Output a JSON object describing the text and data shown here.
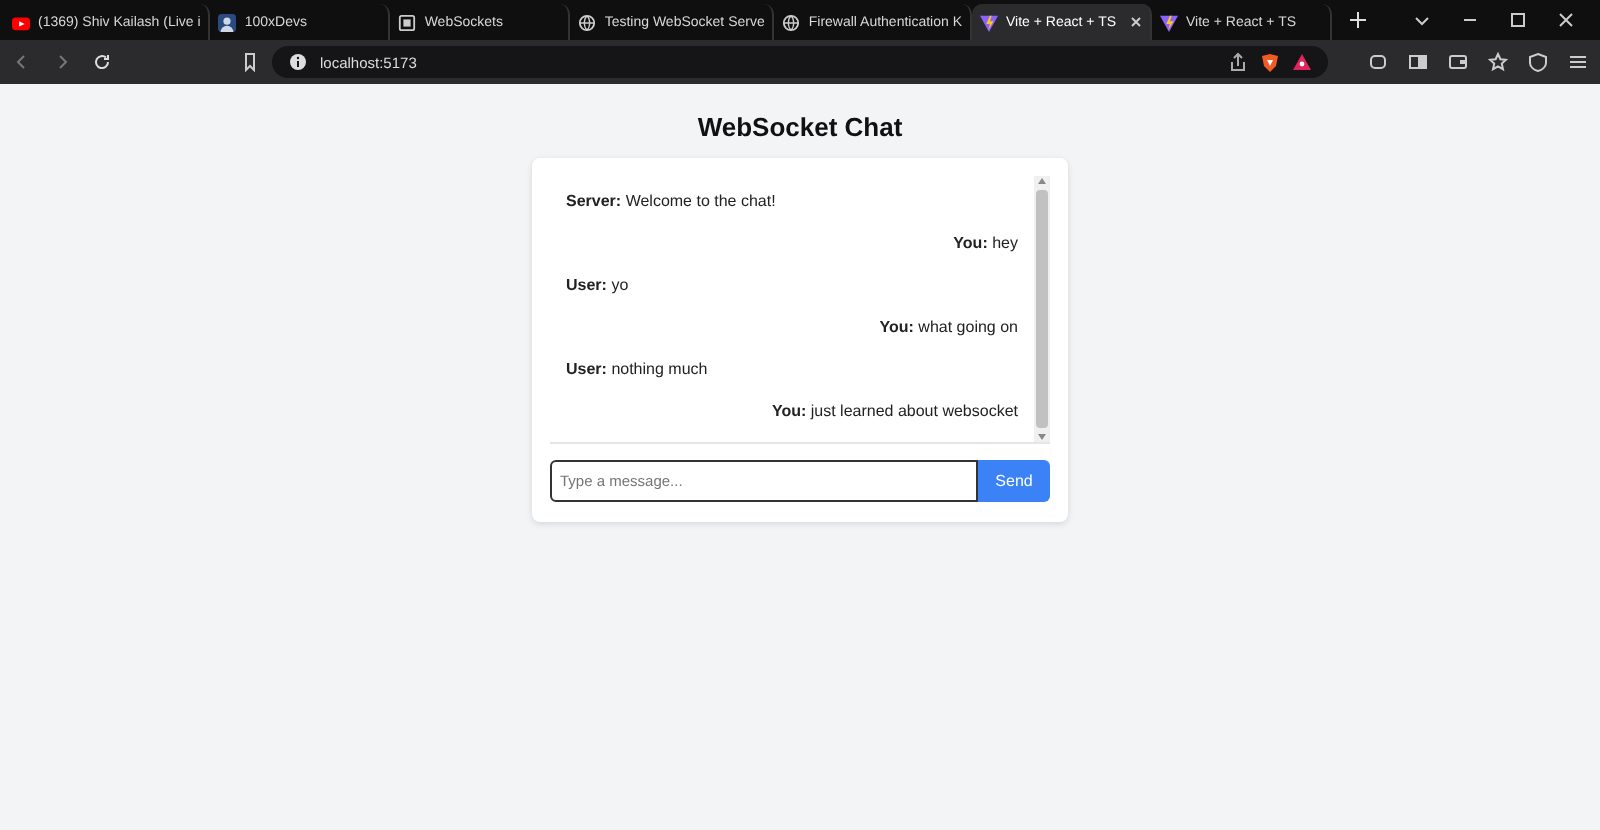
{
  "browser": {
    "tabs": [
      {
        "title": "(1369) Shiv Kailash (Live i",
        "kind": "video",
        "selected": false
      },
      {
        "title": "100xDevs",
        "kind": "avatar",
        "selected": false
      },
      {
        "title": "WebSockets",
        "kind": "page",
        "selected": false
      },
      {
        "title": "Testing WebSocket Serve",
        "kind": "globe",
        "selected": false
      },
      {
        "title": "Firewall Authentication K",
        "kind": "globe",
        "selected": false
      },
      {
        "title": "Vite + React + TS",
        "kind": "vite",
        "selected": true
      },
      {
        "title": "Vite + React + TS",
        "kind": "vite",
        "selected": false
      }
    ],
    "address": "localhost:5173"
  },
  "page": {
    "title": "WebSocket Chat",
    "messages": [
      {
        "sender": "Server:",
        "text": "Welcome to the chat!",
        "kind": "incoming"
      },
      {
        "sender": "You:",
        "text": "hey",
        "kind": "outgoing"
      },
      {
        "sender": "User:",
        "text": "yo",
        "kind": "incoming"
      },
      {
        "sender": "You:",
        "text": "what going on",
        "kind": "outgoing"
      },
      {
        "sender": "User:",
        "text": "nothing much",
        "kind": "incoming"
      },
      {
        "sender": "You:",
        "text": "just learned about websocket",
        "kind": "outgoing"
      }
    ],
    "input": {
      "placeholder": "Type a message..."
    },
    "send_button": "Send"
  }
}
